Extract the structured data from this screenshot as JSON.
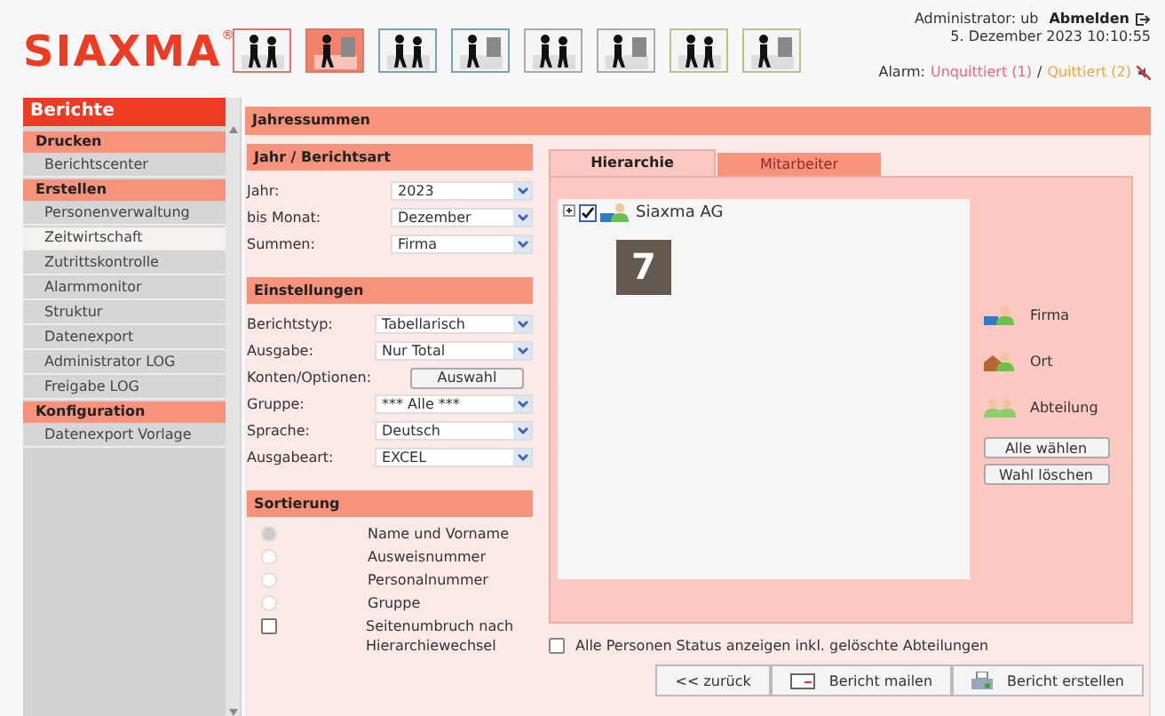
{
  "header": {
    "logo": "SIAXMA",
    "logo_mark": "®",
    "mode_icons": [
      {
        "selected": false,
        "color": "#d9776a"
      },
      {
        "selected": true,
        "color": "#d9776a"
      },
      {
        "selected": false,
        "color": "#6fa7b0"
      },
      {
        "selected": false,
        "color": "#6fa7b0"
      },
      {
        "selected": false,
        "color": "#a9a9a9"
      },
      {
        "selected": false,
        "color": "#a9a9a9"
      },
      {
        "selected": false,
        "color": "#b9c48a"
      },
      {
        "selected": false,
        "color": "#b9c48a"
      }
    ],
    "user": "Administrator: ub",
    "logout": "Abmelden",
    "datetime": "5. Dezember 2023 10:10:55",
    "alarm": {
      "label": "Alarm:",
      "unacknowledged": "Unquittiert (1)",
      "separator": "/",
      "acknowledged": "Quittiert (2)"
    }
  },
  "sidebar": {
    "title": "Berichte",
    "sections": [
      {
        "title": "Drucken",
        "items": [
          {
            "label": "Berichtscenter",
            "selected": false
          }
        ]
      },
      {
        "title": "Erstellen",
        "items": [
          {
            "label": "Personenverwaltung",
            "selected": false
          },
          {
            "label": "Zeitwirtschaft",
            "selected": true
          },
          {
            "label": "Zutrittskontrolle",
            "selected": false
          },
          {
            "label": "Alarmmonitor",
            "selected": false
          },
          {
            "label": "Struktur",
            "selected": false
          },
          {
            "label": "Datenexport",
            "selected": false
          },
          {
            "label": "Administrator LOG",
            "selected": false
          },
          {
            "label": "Freigabe LOG",
            "selected": false
          }
        ]
      },
      {
        "title": "Konfiguration",
        "items": [
          {
            "label": "Datenexport Vorlage",
            "selected": false
          }
        ]
      }
    ]
  },
  "page_title": "Jahressummen",
  "form_sections": [
    {
      "title": "Jahr / Berichtsart",
      "fields": [
        {
          "kind": "select",
          "label": "Jahr:",
          "value": "2023"
        },
        {
          "kind": "select",
          "label": "bis Monat:",
          "value": "Dezember"
        },
        {
          "kind": "select",
          "label": "Summen:",
          "value": "Firma"
        }
      ]
    },
    {
      "title": "Einstellungen",
      "fields": [
        {
          "kind": "select",
          "label": "Berichtstyp:",
          "value": "Tabellarisch"
        },
        {
          "kind": "select",
          "label": "Ausgabe:",
          "value": "Nur Total"
        },
        {
          "kind": "button",
          "label": "Konten/Optionen:",
          "value": "Auswahl"
        },
        {
          "kind": "select",
          "label": "Gruppe:",
          "value": "*** Alle ***"
        },
        {
          "kind": "select",
          "label": "Sprache:",
          "value": "Deutsch"
        },
        {
          "kind": "select",
          "label": "Ausgabeart:",
          "value": "EXCEL"
        }
      ]
    }
  ],
  "sorting": {
    "title": "Sortierung",
    "options": [
      {
        "kind": "radio",
        "label": "Name und Vorname",
        "selected": true
      },
      {
        "kind": "radio",
        "label": "Ausweisnummer",
        "selected": false
      },
      {
        "kind": "radio",
        "label": "Personalnummer",
        "selected": false
      },
      {
        "kind": "radio",
        "label": "Gruppe",
        "selected": false
      },
      {
        "kind": "checkbox",
        "label": "Seitenumbruch nach Hierarchiewechsel",
        "checked": false
      }
    ]
  },
  "tabs": [
    {
      "label": "Hierarchie",
      "selected": true
    },
    {
      "label": "Mitarbeiter",
      "selected": false
    }
  ],
  "tree": [
    {
      "label": "Siaxma AG",
      "checked": true,
      "expanded": false
    }
  ],
  "badge": "7",
  "legend": [
    {
      "kind": "company",
      "label": "Firma"
    },
    {
      "kind": "location",
      "label": "Ort"
    },
    {
      "kind": "department",
      "label": "Abteilung"
    }
  ],
  "tree_buttons": [
    "Alle wählen",
    "Wahl löschen"
  ],
  "show_all": {
    "label": "Alle Personen Status anzeigen inkl. gelöschte Abteilungen",
    "checked": false
  },
  "actions": [
    {
      "kind": "back",
      "label": "<< zurück"
    },
    {
      "kind": "mail",
      "label": "Bericht mailen"
    },
    {
      "kind": "print",
      "label": "Bericht erstellen"
    }
  ]
}
